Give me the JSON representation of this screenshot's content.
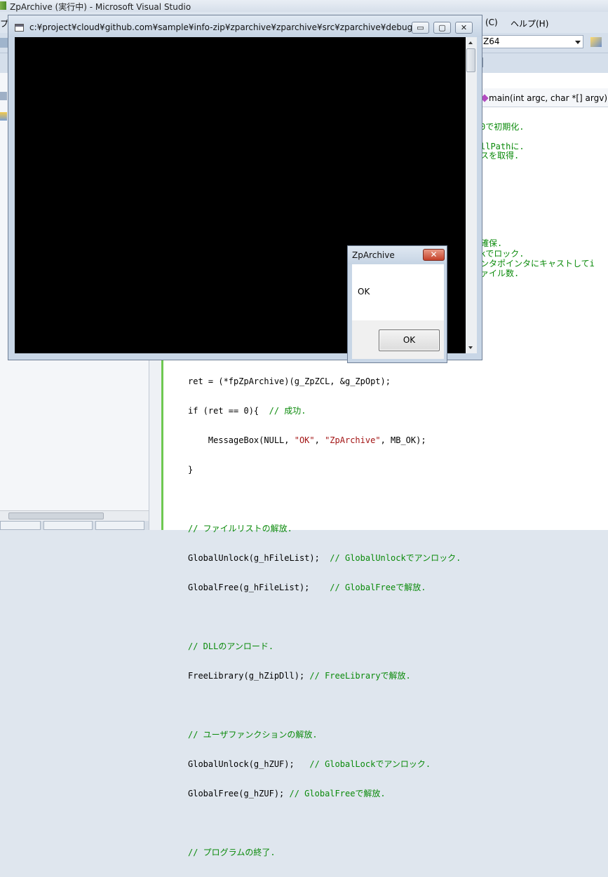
{
  "vs": {
    "title": "ZpArchive (実行中) - Microsoft Visual Studio",
    "menu_left_fragment": "プ",
    "menu_tools_fragment": "(C)",
    "menu_help": "ヘルプ(H)",
    "config_combo": "Z64",
    "member_combo": "main(int argc, char *[] argv)"
  },
  "console": {
    "title": "c:¥project¥cloud¥github.com¥sample¥info-zip¥zparchive¥zparchive¥src¥zparchive¥debug¥...",
    "minimize": "▭",
    "maximize": "▢",
    "close": "✕"
  },
  "msgbox": {
    "title": "ZpArchive",
    "close": "✕",
    "message": "OK",
    "ok_button": "OK"
  },
  "code_fragments": {
    "f1": "0で初期化.",
    "f2": "llPathに.",
    "f3": "スを取得.",
    "f4": "確保.",
    "f5": "kでロック.",
    "f6": "ンタポインタにキャストしてi",
    "f7": "ァイル数."
  },
  "code": {
    "l0": "ret = (*fpZpArchive)(g_ZpZCL, &g_ZpOpt);",
    "l1": "if (ret == 0){",
    "l1c": "  // 成功.",
    "l2a": "    MessageBox(NULL, ",
    "l2b": "\"OK\"",
    "l2c": ", ",
    "l2d": "\"ZpArchive\"",
    "l2e": ", MB_OK);",
    "l3": "}",
    "l5": "// ファイルリストの解放.",
    "l6": "GlobalUnlock(g_hFileList);",
    "l6c": "  // GlobalUnlockでアンロック.",
    "l7": "GlobalFree(g_hFileList);",
    "l7c": "    // GlobalFreeで解放.",
    "l9": "// DLLのアンロード.",
    "l10": "FreeLibrary(g_hZipDll);",
    "l10c": " // FreeLibraryで解放.",
    "l12": "// ユーザファンクションの解放.",
    "l13": "GlobalUnlock(g_hZUF);",
    "l13c": "   // GlobalLockでアンロック.",
    "l14": "GlobalFree(g_hZUF);",
    "l14c": " // GlobalFreeで解放.",
    "l16": "// プログラムの終了."
  }
}
